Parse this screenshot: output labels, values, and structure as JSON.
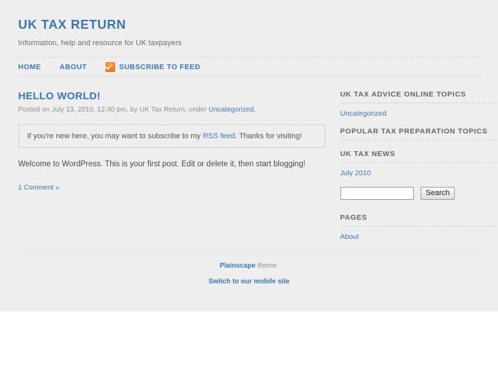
{
  "site": {
    "title": "UK TAX RETURN",
    "description": "Information, help and resource for UK taxpayers"
  },
  "nav": {
    "items": [
      {
        "label": "HOME",
        "name": "home"
      },
      {
        "label": "ABOUT",
        "name": "about"
      },
      {
        "label": "SUBSCRIBE TO FEED",
        "name": "subscribe-to-feed",
        "icon": "rss-icon"
      }
    ]
  },
  "post": {
    "title": "HELLO WORLD!",
    "meta_prefix": "Posted on ",
    "meta_date": "July 13, 2010, 12:40 pm",
    "meta_by": ", by ",
    "meta_author": "UK Tax Return",
    "meta_under": ", under ",
    "meta_category": "Uncategorized",
    "meta_suffix": ".",
    "subscribe_box": {
      "text_before": "If you're new here, you may want to subscribe to my ",
      "link": "RSS feed",
      "text_after": ". Thanks for visiting!"
    },
    "body": "Welcome to WordPress. This is your first post. Edit or delete it, then start blogging!",
    "comments_link": "1 Comment »"
  },
  "sidebar": {
    "widgets": [
      {
        "title": "UK TAX ADVICE ONLINE TOPICS",
        "name": "categories",
        "items": [
          "Uncategorized"
        ]
      },
      {
        "title": "POPULAR TAX PREPARATION TOPICS",
        "name": "popular-topics",
        "items": []
      },
      {
        "title": "UK TAX NEWS",
        "name": "archives",
        "items": [
          "July 2010"
        ]
      }
    ],
    "search": {
      "value": "",
      "placeholder": "",
      "button_label": "Search"
    },
    "pages_widget": {
      "title": "PAGES",
      "items": [
        "About"
      ]
    }
  },
  "footer": {
    "theme_link": "Plainscape",
    "theme_suffix": " theme.",
    "mobile_link": "Switch to our mobile site"
  },
  "colors": {
    "link": "#3a77b8",
    "page_bg": "#eeeeee",
    "heading": "#646464",
    "rss_orange": "#e87b18"
  }
}
